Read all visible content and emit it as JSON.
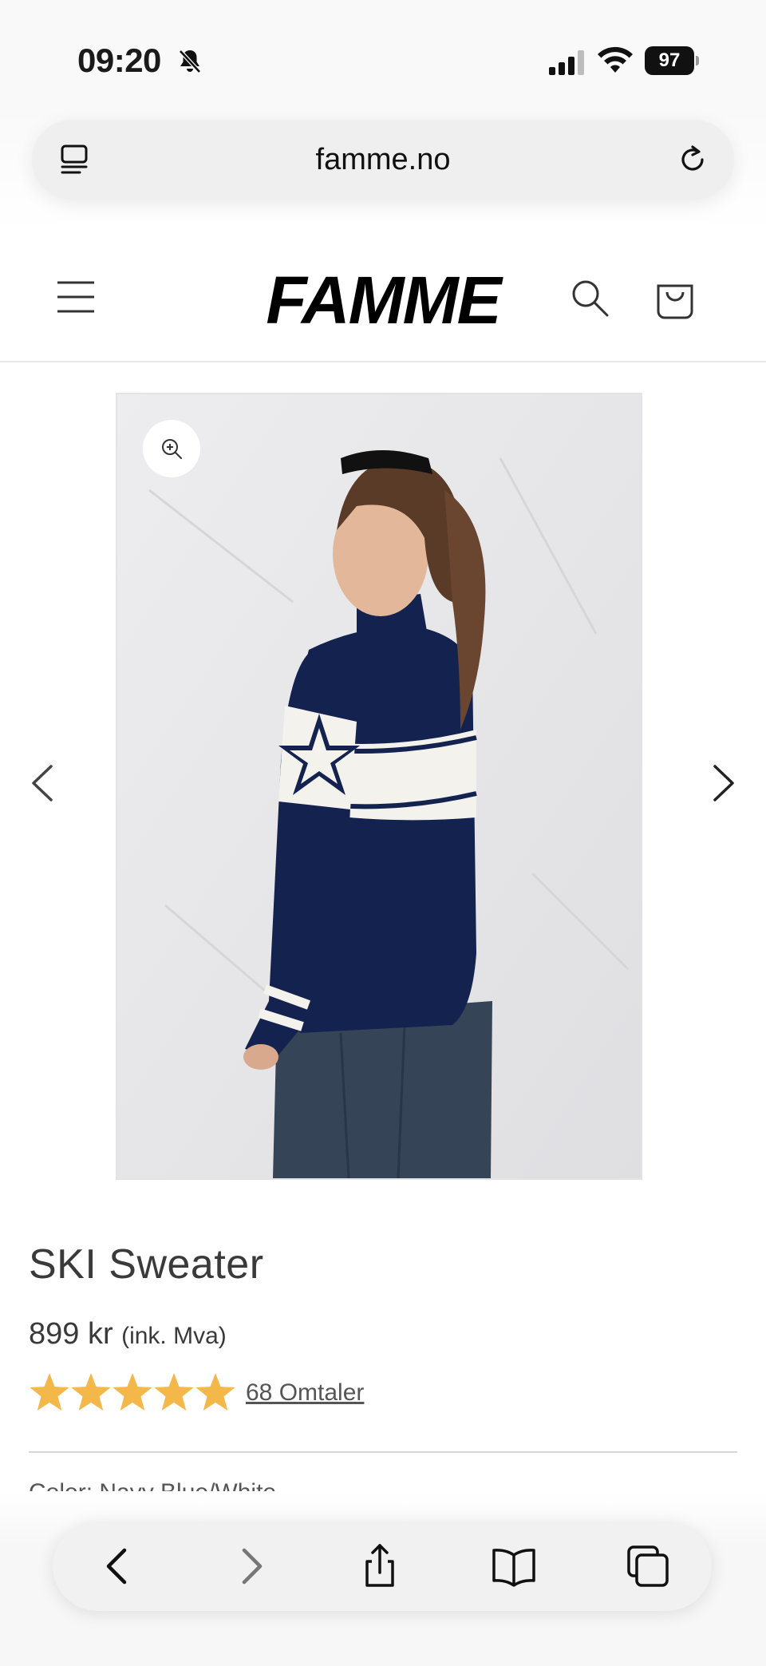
{
  "status_bar": {
    "time": "09:20",
    "battery": "97",
    "icons": [
      "bell-slash-icon",
      "signal-icon",
      "wifi-icon",
      "battery-icon"
    ]
  },
  "browser": {
    "url": "famme.no",
    "icons": [
      "tab-overview-icon",
      "reload-icon"
    ],
    "toolbar": [
      "back-icon",
      "forward-icon",
      "share-icon",
      "bookmarks-icon",
      "tabs-icon"
    ]
  },
  "site": {
    "logo": "FAMME",
    "icons": [
      "menu-icon",
      "search-icon",
      "cart-icon"
    ]
  },
  "product": {
    "title": "SKI Sweater",
    "price": "899 kr",
    "vat_note": "(ink. Mva)",
    "rating": 5,
    "rating_max": 5,
    "reviews_label": "68 Omtaler",
    "color_line": "Color: Navy Blue/White",
    "accent_color": "#f4b74a",
    "sweater_color": "#14224f"
  },
  "gallery": {
    "icons": [
      "zoom-in-icon",
      "chevron-left-icon",
      "chevron-right-icon"
    ]
  }
}
